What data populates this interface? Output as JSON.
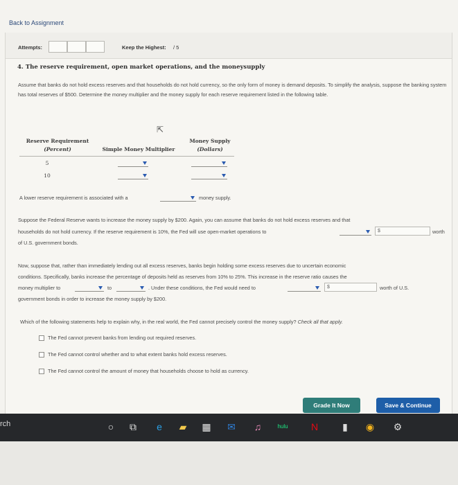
{
  "nav": {
    "back_label": "Back to Assignment"
  },
  "attempts": {
    "label": "Attempts:",
    "keep_label": "Keep the Highest:",
    "keep_value": "/ 5"
  },
  "question": {
    "title": "4. The reserve requirement, open market operations, and the moneysupply",
    "intro": "Assume that banks do not hold excess reserves and that households do not hold currency, so the only form of money is demand deposits. To simplify the analysis, suppose the banking system has total reserves of $500. Determine the money multiplier and the money supply for each reserve requirement listed in the following table."
  },
  "table": {
    "col1_line1": "Reserve Requirement",
    "col1_line2": "(Percent)",
    "col2": "Simple Money Multiplier",
    "col3_line1": "Money Supply",
    "col3_line2": "(Dollars)",
    "rows": [
      {
        "rr": "5"
      },
      {
        "rr": "10"
      }
    ]
  },
  "statement1": {
    "before": "A lower reserve requirement is associated with a",
    "after": "money supply."
  },
  "fed": {
    "line1": "Suppose the Federal Reserve wants to increase the money supply by $200. Again, you can assume that banks do not hold excess reserves and that",
    "line2": "households do not hold currency. If the reserve requirement is 10%, the Fed will use open-market operations to",
    "dollar": "$",
    "worth": "worth",
    "line3": "of U.S. government bonds."
  },
  "excess": {
    "line1": "Now, suppose that, rather than immediately lending out all excess reserves, banks begin holding some excess reserves due to uncertain economic",
    "line2": "conditions. Specifically, banks increase the percentage of deposits held as reserves from 10% to 25%. This increase in the reserve ratio causes the",
    "mm_label": "money multiplier to",
    "to": "to",
    "under": ". Under these conditions, the Fed would need to",
    "dollar": "$",
    "worth_us": "worth of U.S.",
    "line4": "government bonds in order to increase the money supply by $200."
  },
  "checklist": {
    "prompt": "Which of the following statements help to explain why, in the real world, the Fed cannot precisely control the money supply?",
    "hint": "Check all that apply.",
    "items": [
      "The Fed cannot prevent banks from lending out required reserves.",
      "The Fed cannot control whether and to what extent banks hold excess reserves.",
      "The Fed cannot control the amount of money that households choose to hold as currency."
    ]
  },
  "buttons": {
    "grade": "Grade It Now",
    "save": "Save & Continue"
  },
  "taskbar": {
    "search_fragment": "rch"
  },
  "colors": {
    "grade_button": "#2f7d79",
    "save_button": "#1e5ea8",
    "dropdown_caret": "#2a5bb0",
    "taskbar": "#26282b"
  }
}
